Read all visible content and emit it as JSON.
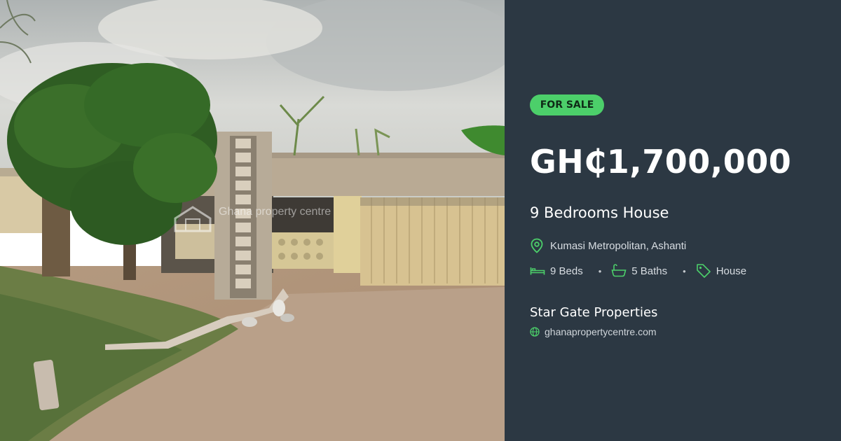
{
  "photo": {
    "watermark": "Ghana property centre"
  },
  "listing": {
    "badge": "FOR SALE",
    "price": "GH₵1,700,000",
    "title": "9 Bedrooms House",
    "location": "Kumasi Metropolitan, Ashanti",
    "beds": "9 Beds",
    "baths": "5 Baths",
    "type": "House",
    "agent": "Star Gate Properties",
    "website": "ghanapropertycentre.com"
  },
  "icons": {
    "location": "map-pin-icon",
    "beds": "bed-icon",
    "baths": "bathtub-icon",
    "type": "tag-icon",
    "website": "globe-icon"
  },
  "colors": {
    "panel_bg": "#2c3843",
    "accent": "#4ccf6a",
    "text": "#ffffff"
  }
}
